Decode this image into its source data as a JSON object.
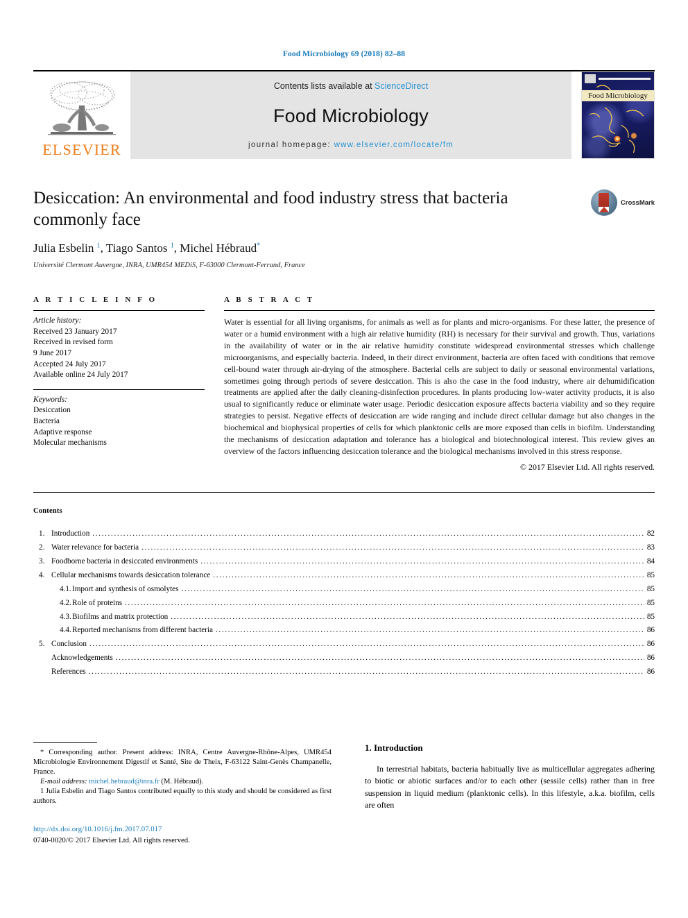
{
  "running_head": "Food Microbiology 69 (2018) 82–88",
  "masthead": {
    "publisher_name": "ELSEVIER",
    "contents_prefix": "Contents lists available at ",
    "sciencedirect": "ScienceDirect",
    "journal_name": "Food Microbiology",
    "homepage_label": "journal homepage: ",
    "homepage_url": "www.elsevier.com/locate/fm",
    "cover_title": "Food Microbiology"
  },
  "article": {
    "title": "Desiccation: An environmental and food industry stress that bacteria commonly face",
    "crossmark_label": "CrossMark",
    "authors_html": "Julia Esbelin <sup>1</sup>, Tiago Santos <sup>1</sup>, Michel Hébraud<sup>*</sup>",
    "affiliation": "Université Clermont Auvergne, INRA, UMR454 MEDiS, F-63000 Clermont-Ferrand, France"
  },
  "article_info": {
    "heading": "A R T I C L E   I N F O",
    "history_title": "Article history:",
    "history": [
      "Received 23 January 2017",
      "Received in revised form",
      "9 June 2017",
      "Accepted 24 July 2017",
      "Available online 24 July 2017"
    ],
    "keywords_title": "Keywords:",
    "keywords": [
      "Desiccation",
      "Bacteria",
      "Adaptive response",
      "Molecular mechanisms"
    ]
  },
  "abstract": {
    "heading": "A B S T R A C T",
    "text": "Water is essential for all living organisms, for animals as well as for plants and micro-organisms. For these latter, the presence of water or a humid environment with a high air relative humidity (RH) is necessary for their survival and growth. Thus, variations in the availability of water or in the air relative humidity constitute widespread environmental stresses which challenge microorganisms, and especially bacteria. Indeed, in their direct environment, bacteria are often faced with conditions that remove cell-bound water through air-drying of the atmosphere. Bacterial cells are subject to daily or seasonal environmental variations, sometimes going through periods of severe desiccation. This is also the case in the food industry, where air dehumidification treatments are applied after the daily cleaning-disinfection procedures. In plants producing low-water activity products, it is also usual to significantly reduce or eliminate water usage. Periodic desiccation exposure affects bacteria viability and so they require strategies to persist. Negative effects of desiccation are wide ranging and include direct cellular damage but also changes in the biochemical and biophysical properties of cells for which planktonic cells are more exposed than cells in biofilm. Understanding the mechanisms of desiccation adaptation and tolerance has a biological and biotechnological interest. This review gives an overview of the factors influencing desiccation tolerance and the biological mechanisms involved in this stress response.",
    "copyright": "© 2017 Elsevier Ltd. All rights reserved."
  },
  "contents": {
    "heading": "Contents",
    "items": [
      {
        "num": "1.",
        "label": "Introduction",
        "page": "82",
        "level": 1
      },
      {
        "num": "2.",
        "label": "Water relevance for bacteria",
        "page": "83",
        "level": 1
      },
      {
        "num": "3.",
        "label": "Foodborne bacteria in desiccated environments",
        "page": "84",
        "level": 1
      },
      {
        "num": "4.",
        "label": "Cellular mechanisms towards desiccation tolerance",
        "page": "85",
        "level": 1
      },
      {
        "num": "4.1.",
        "label": "Import and synthesis of osmolytes",
        "page": "85",
        "level": 2
      },
      {
        "num": "4.2.",
        "label": "Role of proteins",
        "page": "85",
        "level": 2
      },
      {
        "num": "4.3.",
        "label": "Biofilms and matrix protection",
        "page": "85",
        "level": 2
      },
      {
        "num": "4.4.",
        "label": "Reported mechanisms from different bacteria",
        "page": "86",
        "level": 2
      },
      {
        "num": "5.",
        "label": "Conclusion",
        "page": "86",
        "level": 1
      },
      {
        "num": "",
        "label": "Acknowledgements",
        "page": "86",
        "level": 1
      },
      {
        "num": "",
        "label": "References",
        "page": "86",
        "level": 1
      }
    ]
  },
  "footnotes": {
    "corresponding": "* Corresponding author. Present address: INRA, Centre Auvergne-Rhône-Alpes, UMR454 Microbiologie Environnement Digestif et Santé, Site de Theix, F-63122 Saint-Genès Champanelle, France.",
    "email_label": "E-mail address: ",
    "email": "michel.hebraud@inra.fr",
    "email_suffix": " (M. Hébraud).",
    "equal_contribution": "1 Julia Esbelin and Tiago Santos contributed equally to this study and should be considered as first authors.",
    "doi": "http://dx.doi.org/10.1016/j.fm.2017.07.017",
    "issn_copyright": "0740-0020/© 2017 Elsevier Ltd. All rights reserved."
  },
  "introduction": {
    "heading": "1. Introduction",
    "paragraph": "In terrestrial habitats, bacteria habitually live as multicellular aggregates adhering to biotic or abiotic surfaces and/or to each other (sessile cells) rather than in free suspension in liquid medium (planktonic cells). In this lifestyle, a.k.a. biofilm, cells are often"
  },
  "colors": {
    "link": "#1a7bb9",
    "sciencedirect": "#2a93d1",
    "elsevier_orange": "#ef7d1a",
    "masthead_bg": "#e4e4e4",
    "cover_navy": "#131a57"
  }
}
